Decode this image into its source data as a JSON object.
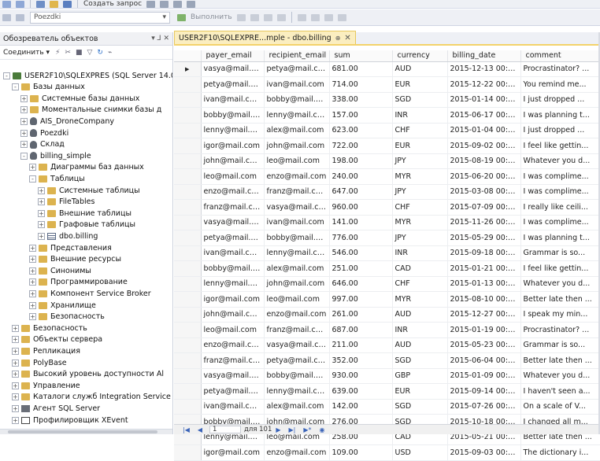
{
  "toolbar": {
    "new_query_label": "Создать запрос",
    "database_value": "Poezdki",
    "execute_label": "Выполнить"
  },
  "explorer": {
    "title": "Обозреватель объектов",
    "pin_symbol": "▾ ⅃ ✕",
    "connect_label": "Соединить ▾",
    "tree": [
      {
        "label": "USER2F10\\SQLEXPRES (SQL Server 14.0.",
        "level": 0,
        "expander": "-",
        "icon": "server"
      },
      {
        "label": "Базы данных",
        "level": 1,
        "expander": "-",
        "icon": "folder"
      },
      {
        "label": "Системные базы данных",
        "level": 2,
        "expander": "+",
        "icon": "folder"
      },
      {
        "label": "Моментальные снимки базы д",
        "level": 2,
        "expander": "+",
        "icon": "folder"
      },
      {
        "label": "AIS_DroneCompany",
        "level": 2,
        "expander": "+",
        "icon": "db"
      },
      {
        "label": "Poezdki",
        "level": 2,
        "expander": "+",
        "icon": "db"
      },
      {
        "label": "Склад",
        "level": 2,
        "expander": "+",
        "icon": "db"
      },
      {
        "label": "billing_simple",
        "level": 2,
        "expander": "-",
        "icon": "db"
      },
      {
        "label": "Диаграммы баз данных",
        "level": 3,
        "expander": "+",
        "icon": "folder"
      },
      {
        "label": "Таблицы",
        "level": 3,
        "expander": "-",
        "icon": "folder"
      },
      {
        "label": "Системные таблицы",
        "level": 4,
        "expander": "+",
        "icon": "folder"
      },
      {
        "label": "FileTables",
        "level": 4,
        "expander": "+",
        "icon": "folder"
      },
      {
        "label": "Внешние таблицы",
        "level": 4,
        "expander": "+",
        "icon": "folder"
      },
      {
        "label": "Графовые таблицы",
        "level": 4,
        "expander": "+",
        "icon": "folder"
      },
      {
        "label": "dbo.billing",
        "level": 4,
        "expander": "+",
        "icon": "table"
      },
      {
        "label": "Представления",
        "level": 3,
        "expander": "+",
        "icon": "folder"
      },
      {
        "label": "Внешние ресурсы",
        "level": 3,
        "expander": "+",
        "icon": "folder"
      },
      {
        "label": "Синонимы",
        "level": 3,
        "expander": "+",
        "icon": "folder"
      },
      {
        "label": "Программирование",
        "level": 3,
        "expander": "+",
        "icon": "folder"
      },
      {
        "label": "Компонент Service Broker",
        "level": 3,
        "expander": "+",
        "icon": "folder"
      },
      {
        "label": "Хранилище",
        "level": 3,
        "expander": "+",
        "icon": "folder"
      },
      {
        "label": "Безопасность",
        "level": 3,
        "expander": "+",
        "icon": "folder"
      },
      {
        "label": "Безопасность",
        "level": 1,
        "expander": "+",
        "icon": "folder"
      },
      {
        "label": "Объекты сервера",
        "level": 1,
        "expander": "+",
        "icon": "folder"
      },
      {
        "label": "Репликация",
        "level": 1,
        "expander": "+",
        "icon": "folder"
      },
      {
        "label": "PolyBase",
        "level": 1,
        "expander": "+",
        "icon": "folder"
      },
      {
        "label": "Высокий уровень доступности Al",
        "level": 1,
        "expander": "+",
        "icon": "folder"
      },
      {
        "label": "Управление",
        "level": 1,
        "expander": "+",
        "icon": "folder"
      },
      {
        "label": "Каталоги служб Integration Service",
        "level": 1,
        "expander": "+",
        "icon": "folder"
      },
      {
        "label": "Агент SQL Server",
        "level": 1,
        "expander": "+",
        "icon": "agent"
      },
      {
        "label": "Профилировщик XEvent",
        "level": 1,
        "expander": "+",
        "icon": "profiler"
      }
    ]
  },
  "document": {
    "tab_title": "USER2F10\\SQLEXPRE...mple - dbo.billing",
    "tab_pin": "⊕",
    "tab_close": "✕",
    "current_row_marker": "▶",
    "columns": [
      "payer_email",
      "recipient_email",
      "sum",
      "currency",
      "billing_date",
      "comment"
    ],
    "rows": [
      [
        "vasya@mail.com",
        "petya@mail.com",
        "681.00",
        "AUD",
        "2015-12-13 00:0...",
        "Procrastinator? ..."
      ],
      [
        "petya@mail.com",
        "ivan@mail.com",
        "714.00",
        "EUR",
        "2015-12-22 00:0...",
        "You remind me..."
      ],
      [
        "ivan@mail.com",
        "bobby@mail.c...",
        "338.00",
        "SGD",
        "2015-01-14 00:0...",
        "I just dropped ..."
      ],
      [
        "bobby@mail.c...",
        "lenny@mail.com",
        "157.00",
        "INR",
        "2015-06-17 00:0...",
        "I was planning t..."
      ],
      [
        "lenny@mail.com",
        "alex@mail.com",
        "623.00",
        "CHF",
        "2015-01-04 00:0...",
        "I just dropped ..."
      ],
      [
        "igor@mail.com",
        "john@mail.com",
        "722.00",
        "EUR",
        "2015-09-02 00:0...",
        "I feel like gettin..."
      ],
      [
        "john@mail.com",
        "leo@mail.com",
        "198.00",
        "JPY",
        "2015-08-19 00:0...",
        "Whatever you d..."
      ],
      [
        "leo@mail.com",
        "enzo@mail.com",
        "240.00",
        "MYR",
        "2015-06-20 00:0...",
        "I was complime..."
      ],
      [
        "enzo@mail.com",
        "franz@mail.com",
        "647.00",
        "JPY",
        "2015-03-08 00:0...",
        "I was complime..."
      ],
      [
        "franz@mail.com",
        "vasya@mail.com",
        "960.00",
        "CHF",
        "2015-07-09 00:0...",
        "I really like ceili..."
      ],
      [
        "vasya@mail.com",
        "ivan@mail.com",
        "141.00",
        "MYR",
        "2015-11-26 00:0...",
        "I was complime..."
      ],
      [
        "petya@mail.com",
        "bobby@mail.c...",
        "776.00",
        "JPY",
        "2015-05-29 00:0...",
        "I was planning t..."
      ],
      [
        "ivan@mail.com",
        "lenny@mail.com",
        "546.00",
        "INR",
        "2015-09-18 00:0...",
        "Grammar is so..."
      ],
      [
        "bobby@mail.c...",
        "alex@mail.com",
        "251.00",
        "CAD",
        "2015-01-21 00:0...",
        "I feel like gettin..."
      ],
      [
        "lenny@mail.com",
        "john@mail.com",
        "646.00",
        "CHF",
        "2015-01-13 00:0...",
        "Whatever you d..."
      ],
      [
        "igor@mail.com",
        "leo@mail.com",
        "997.00",
        "MYR",
        "2015-08-10 00:0...",
        "Better late then ..."
      ],
      [
        "john@mail.com",
        "enzo@mail.com",
        "261.00",
        "AUD",
        "2015-12-27 00:0...",
        "I speak my min..."
      ],
      [
        "leo@mail.com",
        "franz@mail.com",
        "687.00",
        "INR",
        "2015-01-19 00:0...",
        "Procrastinator? ..."
      ],
      [
        "enzo@mail.com",
        "vasya@mail.com",
        "211.00",
        "AUD",
        "2015-05-23 00:0...",
        "Grammar is so..."
      ],
      [
        "franz@mail.com",
        "petya@mail.com",
        "352.00",
        "SGD",
        "2015-06-04 00:0...",
        "Better late then ..."
      ],
      [
        "vasya@mail.com",
        "bobby@mail.c...",
        "930.00",
        "GBP",
        "2015-01-09 00:0...",
        "Whatever you d..."
      ],
      [
        "petya@mail.com",
        "lenny@mail.com",
        "639.00",
        "EUR",
        "2015-09-14 00:0...",
        "I haven't seen a..."
      ],
      [
        "ivan@mail.com",
        "alex@mail.com",
        "142.00",
        "SGD",
        "2015-07-26 00:0...",
        "On a scale of V..."
      ],
      [
        "bobby@mail.c...",
        "john@mail.com",
        "276.00",
        "SGD",
        "2015-10-18 00:0...",
        "I changed all m..."
      ],
      [
        "lenny@mail.com",
        "leo@mail.com",
        "258.00",
        "CAD",
        "2015-05-21 00:0...",
        "Better late then ..."
      ],
      [
        "igor@mail.com",
        "enzo@mail.com",
        "109.00",
        "USD",
        "2015-09-03 00:0...",
        "The dictionary i..."
      ]
    ],
    "pager": {
      "current": "1",
      "of_label": "для 101"
    }
  },
  "colors": {
    "tab_bg": "#fbeec0",
    "tab_accent": "#f3d26b",
    "folder": "#dcb34f",
    "chrome": "#eef0f5"
  }
}
